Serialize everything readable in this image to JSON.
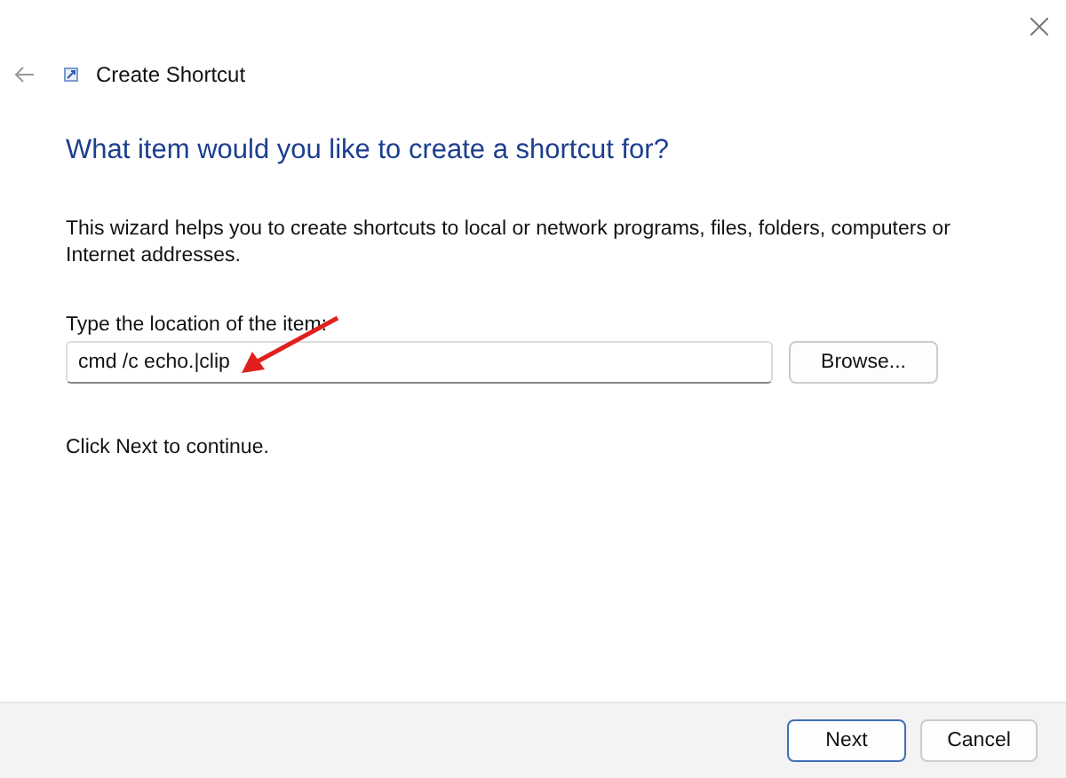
{
  "window": {
    "title": "Create Shortcut"
  },
  "heading": "What item would you like to create a shortcut for?",
  "description": "This wizard helps you to create shortcuts to local or network programs, files, folders, computers or Internet addresses.",
  "location": {
    "label": "Type the location of the item:",
    "value": "cmd /c echo.|clip"
  },
  "browse_button": "Browse...",
  "hint": "Click Next to continue.",
  "buttons": [
    {
      "label": "Next",
      "default": true
    },
    {
      "label": "Cancel",
      "default": false
    }
  ]
}
